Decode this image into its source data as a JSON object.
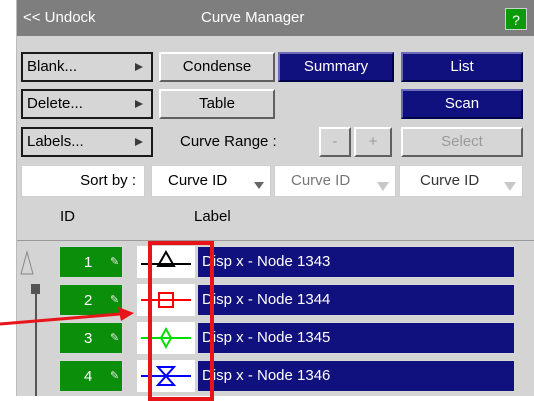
{
  "titlebar": {
    "undock_label": "<< Undock",
    "title": "Curve Manager",
    "help_label": "?"
  },
  "buttons": {
    "blank": "Blank...",
    "condense": "Condense",
    "summary": "Summary",
    "list": "List",
    "delete": "Delete...",
    "table": "Table",
    "scan": "Scan",
    "labels": "Labels...",
    "curve_range_label": "Curve Range :",
    "minus": "-",
    "plus": "+",
    "select": "Select"
  },
  "sort": {
    "label": "Sort by :",
    "keys": [
      "Curve ID",
      "Curve ID",
      "Curve ID"
    ]
  },
  "headers": {
    "id": "ID",
    "label": "Label"
  },
  "rows": [
    {
      "id": "1",
      "label": "Disp x - Node 1343",
      "symbol_color": "#000000",
      "symbol": "triangle-icon"
    },
    {
      "id": "2",
      "label": "Disp x - Node 1344",
      "symbol_color": "#ff0000",
      "symbol": "square-icon"
    },
    {
      "id": "3",
      "label": "Disp x - Node 1345",
      "symbol_color": "#00dd00",
      "symbol": "diamond-icon"
    },
    {
      "id": "4",
      "label": "Disp x - Node 1346",
      "symbol_color": "#0000ff",
      "symbol": "hourglass-icon"
    }
  ],
  "colors": {
    "accent_blue": "#10107e",
    "id_green": "#0b8f0b",
    "highlight_red": "#e8141a"
  }
}
